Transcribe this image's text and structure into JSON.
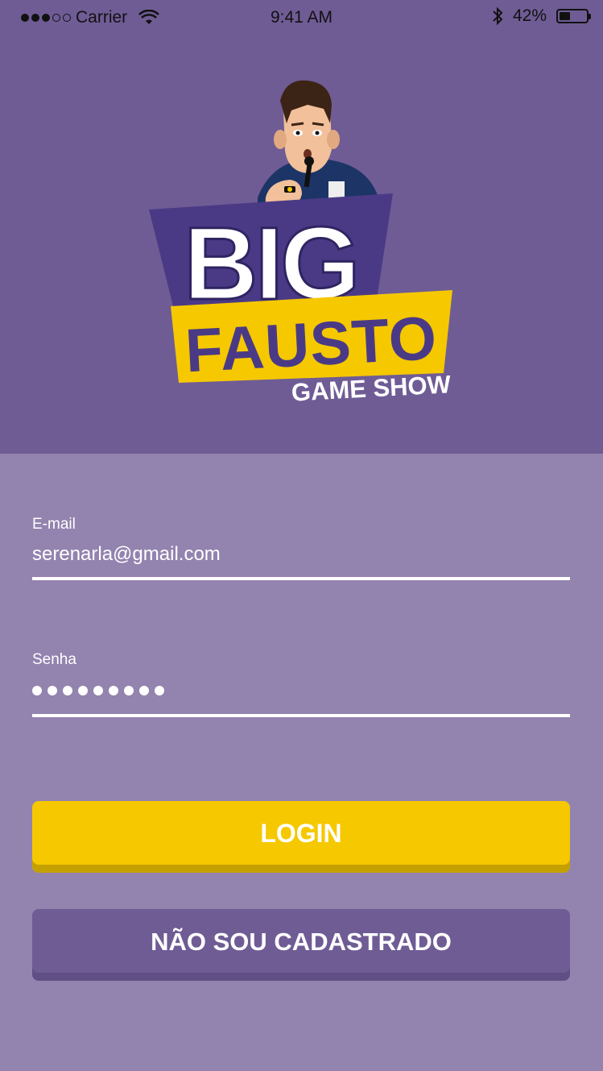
{
  "status_bar": {
    "carrier": "Carrier",
    "time": "9:41 AM",
    "battery_percent": "42%",
    "battery_level": 0.42,
    "icons": [
      "signal-dots-icon",
      "wifi-icon",
      "bluetooth-icon",
      "battery-icon"
    ]
  },
  "logo": {
    "line1": "BIG",
    "line2": "FAUSTO",
    "line3": "GAME SHOW"
  },
  "form": {
    "email": {
      "label": "E-mail",
      "value": "serenarla@gmail.com"
    },
    "password": {
      "label": "Senha",
      "masked_length": 9
    }
  },
  "buttons": {
    "login": "LOGIN",
    "register": "NÃO SOU CADASTRADO"
  },
  "colors": {
    "header_bg": "#6f5c95",
    "form_bg": "#9383af",
    "login_button": "#f5c800",
    "register_button": "#6f5c95",
    "logo_purple": "#4a3a86",
    "logo_yellow": "#f5c800"
  }
}
